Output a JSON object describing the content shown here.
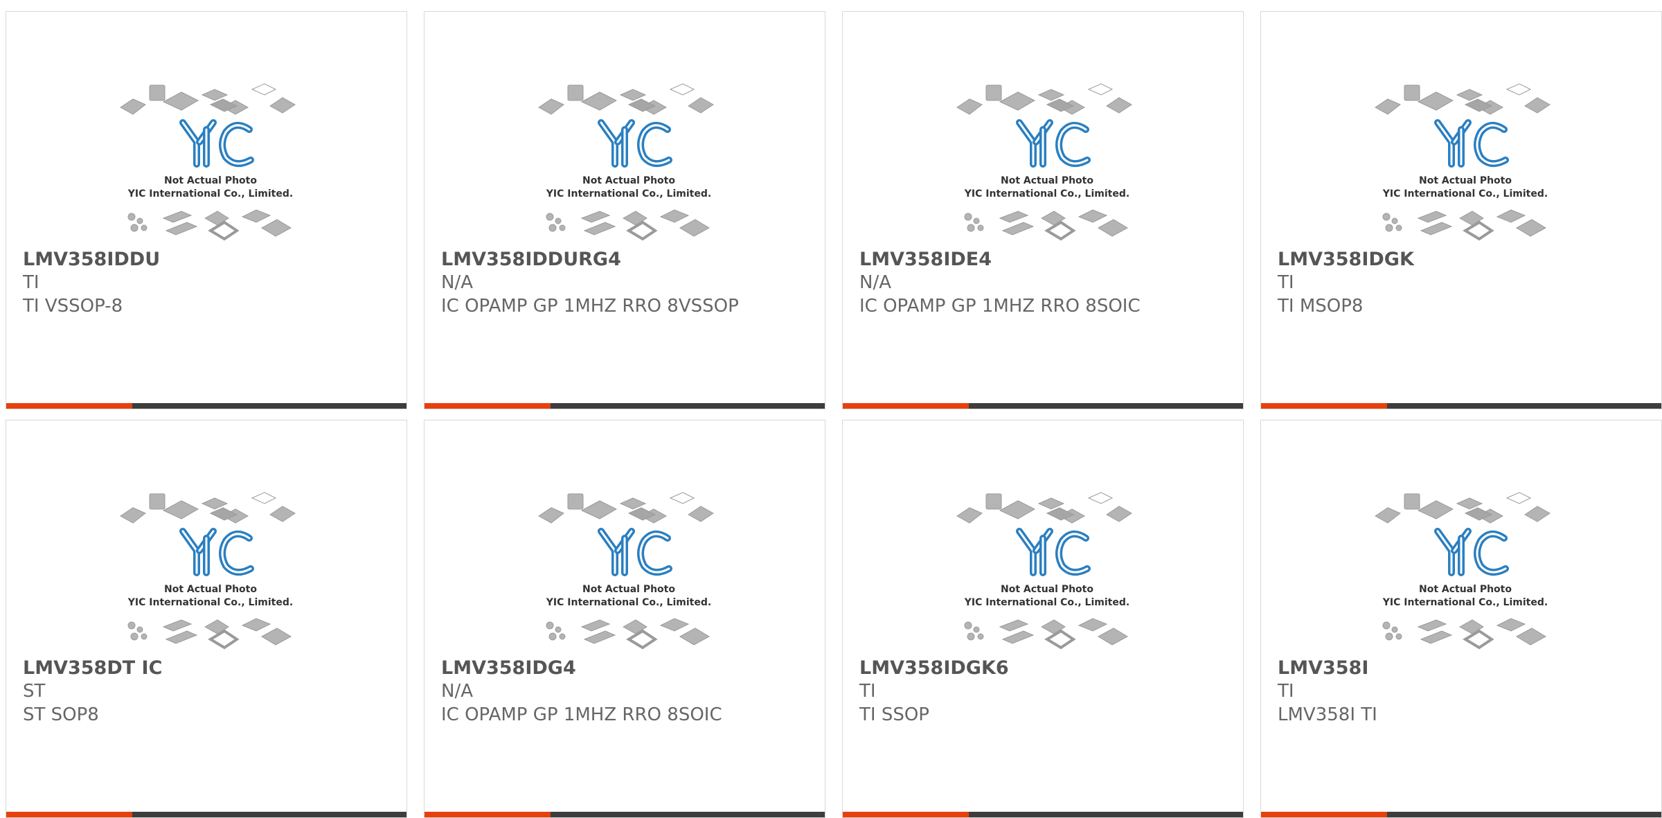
{
  "colors": {
    "accent": "#e8400c",
    "bar": "#3d3d3d",
    "logo": "#2a7fc1",
    "chip": "#b4b4b4"
  },
  "placeholder": {
    "line1": "Not Actual Photo",
    "line2": "YIC International Co., Limited.",
    "logo": "YIC"
  },
  "products": [
    {
      "part": "LMV358IDDU",
      "mfr": "TI",
      "desc": "TI VSSOP-8"
    },
    {
      "part": "LMV358IDDURG4",
      "mfr": "N/A",
      "desc": "IC OPAMP GP 1MHZ RRO 8VSSOP"
    },
    {
      "part": "LMV358IDE4",
      "mfr": "N/A",
      "desc": "IC OPAMP GP 1MHZ RRO 8SOIC"
    },
    {
      "part": "LMV358IDGK",
      "mfr": "TI",
      "desc": "TI MSOP8"
    },
    {
      "part": "LMV358DT IC",
      "mfr": "ST",
      "desc": "ST SOP8"
    },
    {
      "part": "LMV358IDG4",
      "mfr": "N/A",
      "desc": "IC OPAMP GP 1MHZ RRO 8SOIC"
    },
    {
      "part": "LMV358IDGK6",
      "mfr": "TI",
      "desc": "TI SSOP"
    },
    {
      "part": "LMV358I",
      "mfr": "TI",
      "desc": "LMV358I TI"
    }
  ]
}
